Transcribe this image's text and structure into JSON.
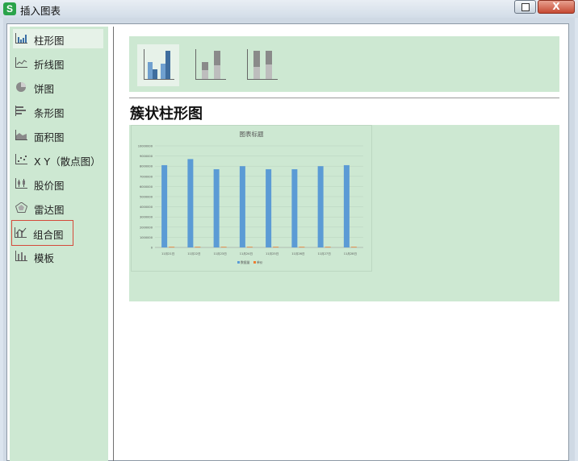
{
  "window": {
    "title": "插入图表",
    "app_icon": "S",
    "close_glyph": "X"
  },
  "sidebar": {
    "items": [
      {
        "label": "柱形图",
        "icon": "column-chart-icon"
      },
      {
        "label": "折线图",
        "icon": "line-chart-icon"
      },
      {
        "label": "饼图",
        "icon": "pie-chart-icon"
      },
      {
        "label": "条形图",
        "icon": "bar-chart-icon"
      },
      {
        "label": "面积图",
        "icon": "area-chart-icon"
      },
      {
        "label": "X Y（散点图）",
        "icon": "scatter-chart-icon"
      },
      {
        "label": "股价图",
        "icon": "stock-chart-icon"
      },
      {
        "label": "雷达图",
        "icon": "radar-chart-icon"
      },
      {
        "label": "组合图",
        "icon": "combo-chart-icon"
      },
      {
        "label": "模板",
        "icon": "template-icon"
      }
    ],
    "selected_index": 0,
    "highlighted_index": 8
  },
  "subtypes": [
    {
      "icon": "clustered-column-icon",
      "selected": true
    },
    {
      "icon": "stacked-column-icon",
      "selected": false
    },
    {
      "icon": "percent-stacked-column-icon",
      "selected": false
    }
  ],
  "main": {
    "chart_type_title": "簇状柱形图"
  },
  "colors": {
    "panel_green": "#cde8d2",
    "series1": "#5b9bd5",
    "series2": "#ed7d31",
    "highlight_border": "#d44a3a"
  },
  "chart_data": {
    "type": "bar",
    "title": "图表标题",
    "categories": [
      "11月21日",
      "11月22日",
      "11月23日",
      "11月24日",
      "11月25日",
      "11月26日",
      "11月27日",
      "11月28日"
    ],
    "series": [
      {
        "name": "数据量",
        "values": [
          8100000,
          8700000,
          7700000,
          8000000,
          7700000,
          7700000,
          8000000,
          8100000
        ]
      },
      {
        "name": "单价",
        "values": [
          60000,
          60000,
          60000,
          60000,
          60000,
          60000,
          60000,
          60000
        ]
      }
    ],
    "yticks": [
      "10000000",
      "9000000",
      "8000000",
      "7000000",
      "6000000",
      "5000000",
      "4000000",
      "3000000",
      "2000000",
      "1000000",
      "0"
    ],
    "ylim": [
      0,
      10000000
    ],
    "grid": true,
    "legend": "bottom"
  }
}
